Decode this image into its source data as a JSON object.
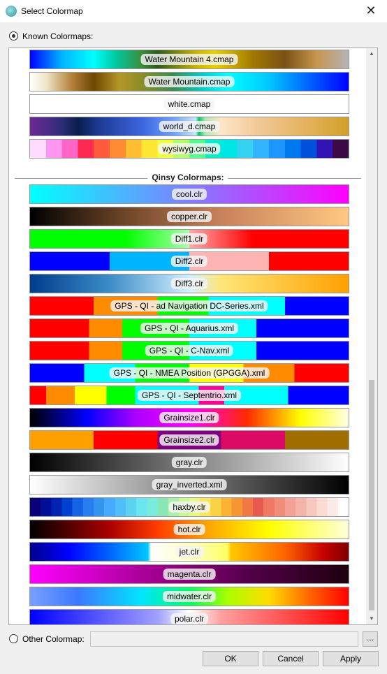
{
  "window": {
    "title": "Select Colormap",
    "close_glyph": "✕"
  },
  "known": {
    "label": "Known Colormaps:"
  },
  "qinsy": {
    "label": "Qinsy Colormaps:"
  },
  "colormaps_known": [
    {
      "label": "Water Mountain 4.cmap",
      "gradient": "linear-gradient(to right,#0000ff 0%,#00b4ff 10%,#00ffff 20%,#00c8a0 27%,#3c8c3c 35%,#2b5a1e 40%,#c8b400 52%,#e8d000 58%,#a07800 70%,#7a5014 80%,#c89650 90%,#b4b4b4 100%)"
    },
    {
      "label": "Water Mountain.cmap",
      "gradient": "linear-gradient(to right,#ffffff 0%,#f0e6c8 5%,#b4823c 13%,#6e4600 20%,#b49628 28%,#8c8c28 35%,#3c8c50 45%,#00d2d2 55%,#00ffff 62%,#00c8ff 75%,#0050ff 90%,#0000ff 100%)"
    },
    {
      "label": "white.cmap",
      "gradient": "linear-gradient(to right,#ffffff,#ffffff)"
    },
    {
      "label": "world_d.cmap",
      "gradient": "linear-gradient(to right,#6e2896 0%,#2d2d78 10%,#0a1e4b 15%,#1e3c96 22%,#3c64dc 35%,#6ea0ff 45%,#c8e6ff 52%,#00c864 53%,#b4e6b4 55%,#ffe6c8 60%,#f0c896 72%,#e6b464 85%,#d2a028 100%)"
    },
    {
      "label": "wysiwyg.cmap",
      "gradient": "linear-gradient(to right,#ffdcff 0% 5%,#ff96f0 5% 10%,#ff64c8 10% 15%,#ff2850 15% 20%,#ff5a3c 20% 25%,#ff8c32 25% 30%,#ffbe32 30% 35%,#ffe632 35% 40%,#f0ff3c 40% 45%,#b4ff64 45% 50%,#50ff8c 50% 55%,#00f0c8 55% 60%,#00e6e6 60% 65%,#32d2f0 65% 70%,#32b4ff 70% 75%,#1e96ff 75% 80%,#0078f0 80% 85%,#0050dc 85% 90%,#3214b4 90% 95%,#3c0a46 95% 100%)"
    }
  ],
  "colormaps_qinsy": [
    {
      "label": "cool.clr",
      "gradient": "linear-gradient(to right,#00ffff,#ff00ff)"
    },
    {
      "label": "copper.clr",
      "gradient": "linear-gradient(to right,#000000,#6e4628 30%,#c8825a 60%,#ffc882 100%)"
    },
    {
      "label": "Diff1.clr",
      "gradient": "linear-gradient(to right,#00ff00 0%,#00ff00 30%,#aaffaa 50%,#ffaaaa 50%,#ff0000 70%,#ff0000 100%)"
    },
    {
      "label": "Diff2.clr",
      "gradient": "linear-gradient(to right,#0000ff 0% 25%,#00b4ff 25% 50%,#ffb4b4 50% 75%,#ff0000 75% 100%)"
    },
    {
      "label": "Diff3.clr",
      "gradient": "linear-gradient(to right,#003c8c 0%,#3c8cc8 25%,#d2f0ff 50%,#ffe678 60%,#ffa000 100%)"
    },
    {
      "label": "GPS - QI - ad Navigation DC-Series.xml",
      "gradient": "linear-gradient(to right,#ff0000 0% 20%,#ff8c00 20% 40%,#00ff00 40% 56%,#00ffff 56% 80%,#0000ff 80% 100%)"
    },
    {
      "label": "GPS - QI - Aquarius.xml",
      "gradient": "linear-gradient(to right,#ff0000 0% 18.5%,#ff8c00 18.5% 29%,#00ff00 29% 50%,#00ffff 50% 71%,#0000ff 71% 100%)"
    },
    {
      "label": "GPS - QI - C-Nav.xml",
      "gradient": "linear-gradient(to right,#ff0000 0% 18.5%,#ff8c00 18.5% 29%,#00ff00 29% 50%,#00ffff 50% 71%,#0000ff 71% 100%)"
    },
    {
      "label": "GPS - QI - NMEA Position (GPGGA).xml",
      "gradient": "linear-gradient(to right,#0000ff 0% 17%,#00ffff 17% 33%,#00ff00 33% 50%,#ffff00 50% 67%,#ff8c00 67% 83%,#ff0000 83% 100%)"
    },
    {
      "label": "GPS - QI - Septentrio.xml",
      "gradient": "linear-gradient(to right,#ff0000 0% 5%,#ff8c00 5% 14%,#ffff00 14% 24%,#00ff00 24% 33%,#00ffff 33% 53%,#ff0096 53% 61%,#00ffff 61% 81%,#0000ff 81% 100%)"
    },
    {
      "label": "Grainsize1.clr",
      "gradient": "linear-gradient(to right,#000000 0%,#0000ff 18%,#aa00ff 33%,#ff00ff 50%,#ff2800 68%,#ffff00 85%,#ffffe6 100%)"
    },
    {
      "label": "Grainsize2.clr",
      "gradient": "linear-gradient(to right,#ffa000 0% 20%,#ff0000 20% 40%,#800080 40% 60%,#dc0a64 60% 80%,#a06e00 80% 100%)"
    },
    {
      "label": "gray.clr",
      "gradient": "linear-gradient(to right,#000000,#ffffff)"
    },
    {
      "label": "gray_inverted.xml",
      "gradient": "linear-gradient(to right,#ffffff,#000000)"
    },
    {
      "label": "haxby.clr",
      "gradient": "linear-gradient(to right,#0a0078 0% 3.3%,#000f96 3.3% 6.7%,#0023b4 6.7% 10%,#0041d2 10% 13.3%,#1464e6 13.3% 16.7%,#287df0 16.7% 20%,#3296f0 20% 23.3%,#46aaff 23.3% 26.7%,#50bef8 26.7% 30%,#5ad2f0 30% 33.3%,#6ae6f0 33.3% 36.7%,#78ebdc 36.7% 40%,#8ae6b4 40% 43.3%,#aaf0aa 43.3% 46.7%,#c8fa96 46.7% 50%,#e6fa82 50% 53.3%,#fae65a 53.3% 56.7%,#fad246 56.7% 60%,#fab432 60% 63.3%,#f59632 63.3% 66.7%,#f07846 66.7% 70%,#e65a50 70% 73.3%,#f07864 73.3% 76.7%,#f08c78 76.7% 80%,#f5a096 80% 83.3%,#f5b4aa 83.3% 86.7%,#f8c8c0 86.7% 90%,#fadcd2 90% 93.3%,#fcebe6 93.3% 96.7%,#ffffff 96.7% 100%)"
    },
    {
      "label": "hot.clr",
      "gradient": "linear-gradient(to right,#000000 0%,#aa0000 25%,#ff3c00 40%,#ffa000 55%,#ffff00 75%,#ffffdc 100%)"
    },
    {
      "label": "jet.clr",
      "gradient": "linear-gradient(to right,#00008c 0%,#0000ff 12%,#0064ff 25%,#00c8ff 37%,#ffffff 38%,#ffffc8 50%,#ffff64 62%,#ffc800 63%,#ff6400 80%,#c80000 92%,#800000 100%)"
    },
    {
      "label": "magenta.clr",
      "gradient": "linear-gradient(to right,#ff00ff,#a0008c 40%,#500046 70%,#1e000f 100%)"
    },
    {
      "label": "midwater.clr",
      "gradient": "linear-gradient(to right,#78a0ff 0%,#3c78ff 15%,#00e6ff 35%,#00ff64 50%,#aaff00 62%,#ffdc00 75%,#ff6400 88%,#ff0000 100%)"
    },
    {
      "label": "polar.clr",
      "gradient": "linear-gradient(to right,#0000ff 0%,#a0a0ff 40%,#ffffff 50%,#ffa0a0 60%,#ff0000 100%)"
    }
  ],
  "other": {
    "label": "Other Colormap:",
    "value": "",
    "browse_label": "..."
  },
  "buttons": {
    "ok": "OK",
    "cancel": "Cancel",
    "apply": "Apply"
  },
  "scrollbar": {
    "up_glyph": "▲",
    "down_glyph": "▼"
  }
}
